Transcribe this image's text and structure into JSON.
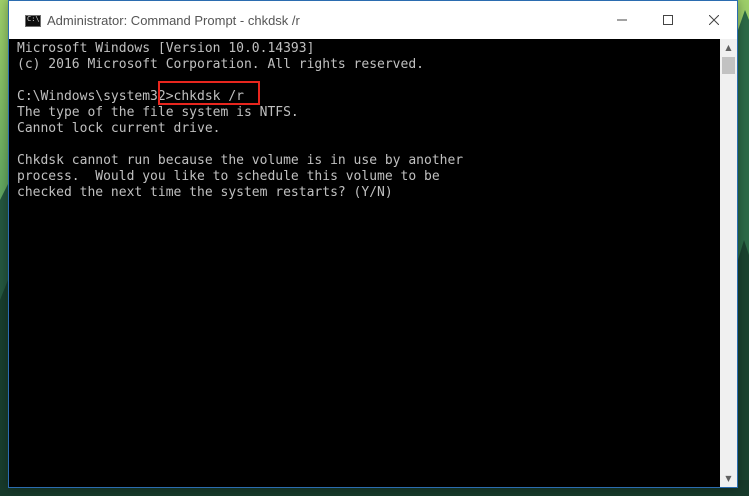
{
  "window": {
    "title": "Administrator: Command Prompt - chkdsk  /r",
    "icon_label": "C:\\"
  },
  "caption_buttons": {
    "minimize_icon": "minimize-icon",
    "maximize_icon": "maximize-icon",
    "close_icon": "close-icon"
  },
  "console": {
    "lines": [
      "Microsoft Windows [Version 10.0.14393]",
      "(c) 2016 Microsoft Corporation. All rights reserved.",
      "",
      "C:\\Windows\\system32>chkdsk /r",
      "The type of the file system is NTFS.",
      "Cannot lock current drive.",
      "",
      "Chkdsk cannot run because the volume is in use by another",
      "process.  Would you like to schedule this volume to be",
      "checked the next time the system restarts? (Y/N)"
    ],
    "highlight_color": "#e8261e"
  },
  "scrollbar": {
    "up_glyph": "▲",
    "down_glyph": "▼"
  }
}
